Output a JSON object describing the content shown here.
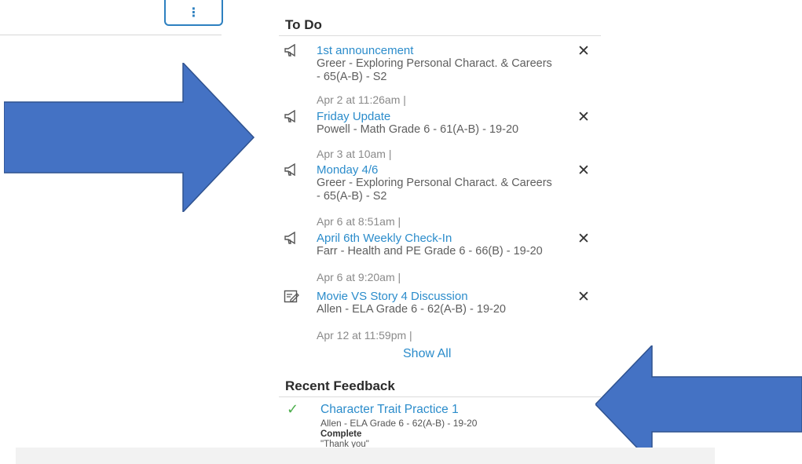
{
  "toolbar": {
    "kebab_glyph": "⋮"
  },
  "todo": {
    "heading": "To Do",
    "items": [
      {
        "icon": "announcement-icon",
        "title": "1st announcement",
        "course": "Greer - Exploring Personal Charact. & Careers - 65(A-B) - S2",
        "date": "Apr 2 at 11:26am  |",
        "close": "✕"
      },
      {
        "icon": "announcement-icon",
        "title": "Friday Update",
        "course": "Powell - Math Grade 6 - 61(A-B) - 19-20",
        "date": "Apr 3 at 10am  |",
        "close": "✕"
      },
      {
        "icon": "announcement-icon",
        "title": "Monday 4/6",
        "course": "Greer - Exploring Personal Charact. & Careers - 65(A-B) - S2",
        "date": "Apr 6 at 8:51am  |",
        "close": "✕"
      },
      {
        "icon": "announcement-icon",
        "title": "April 6th Weekly Check-In",
        "course": "Farr - Health and PE Grade 6 - 66(B) - 19-20",
        "date": "Apr 6 at 9:20am  |",
        "close": "✕"
      },
      {
        "icon": "discussion-icon",
        "title": "Movie VS Story 4 Discussion",
        "course": "Allen - ELA Grade 6 - 62(A-B) - 19-20",
        "date": "Apr 12 at 11:59pm  |",
        "close": "✕"
      }
    ],
    "show_all": "Show All"
  },
  "feedback": {
    "heading": "Recent Feedback",
    "item": {
      "check": "✓",
      "title": "Character Trait Practice 1",
      "course": "Allen - ELA Grade 6 - 62(A-B) - 19-20",
      "status": "Complete",
      "comment": "\"Thank you\""
    }
  },
  "colors": {
    "arrow": "#4472c4",
    "link": "#2b8ccb",
    "check": "#4cae4c"
  }
}
